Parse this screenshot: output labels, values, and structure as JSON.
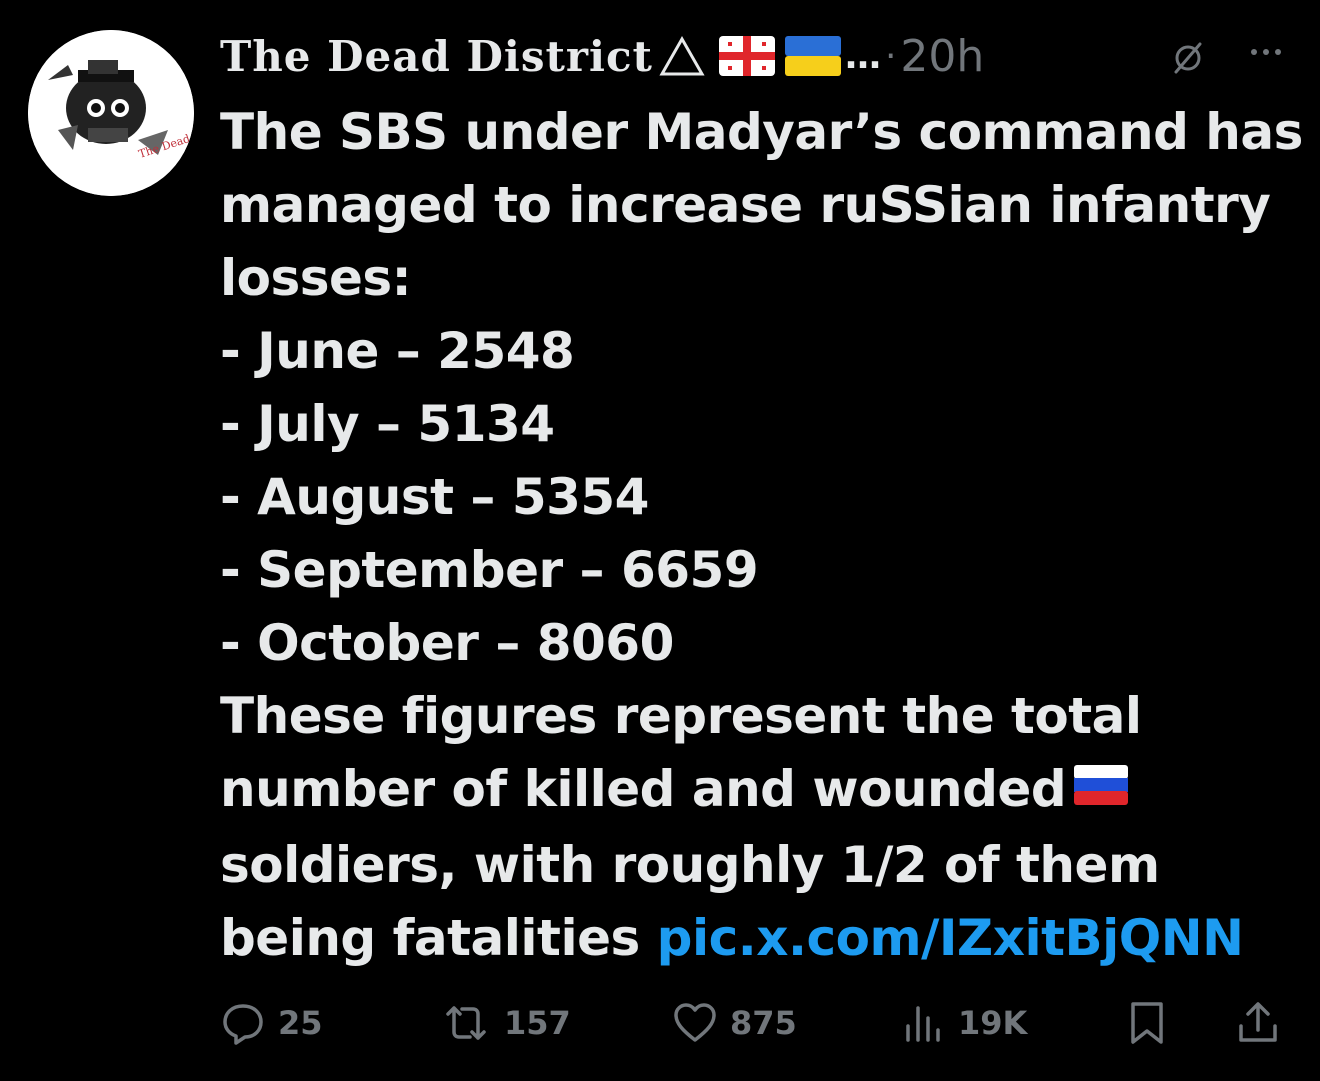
{
  "author": {
    "display_name": "The Dead District",
    "triangle_glyph": "△",
    "flags": [
      "georgia-flag",
      "ukraine-flag"
    ],
    "ellipsis": "…",
    "separator": "·",
    "time": "20h"
  },
  "tweet": {
    "lines": [
      "The SBS under Madyar’s command has",
      "managed to increase ruSSian infantry",
      "losses:",
      "- June – 2548",
      "- July – 5134",
      "- August – 5354",
      "- September – 6659",
      "- October – 8060",
      "These figures represent the total",
      "number of killed and wounded",
      "soldiers, with roughly 1/2 of them",
      "being fatalities "
    ],
    "inline_flag": "russia-flag",
    "link_text": "pic.x.com/IZxitBjQNN"
  },
  "actions": {
    "replies": "25",
    "reposts": "157",
    "likes": "875",
    "views": "19K"
  },
  "colors": {
    "background": "#000000",
    "text": "#e7e9ea",
    "muted": "#71767b",
    "link": "#1d9bf0"
  },
  "icons": [
    "avatar-logo",
    "grok-icon",
    "more-icon",
    "reply-icon",
    "repost-icon",
    "like-icon",
    "views-icon",
    "bookmark-icon",
    "share-icon"
  ]
}
